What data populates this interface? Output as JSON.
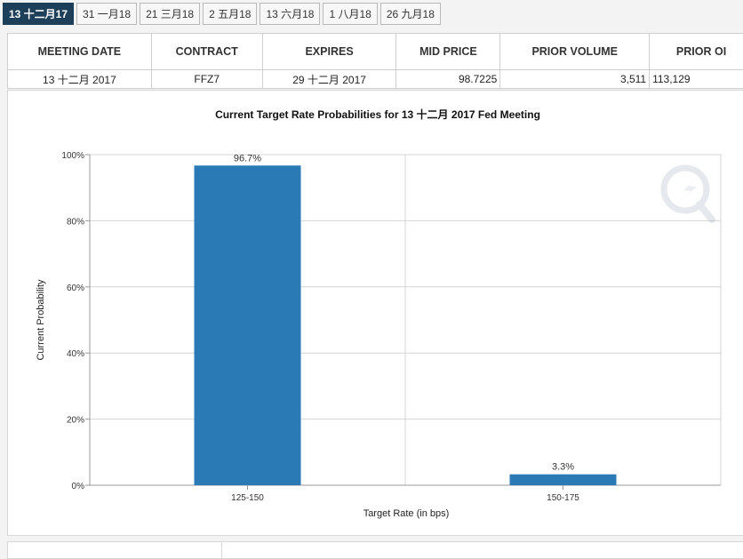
{
  "tabs": [
    "13 十二月17",
    "31 一月18",
    "21 三月18",
    "2 五月18",
    "13 六月18",
    "1 八月18",
    "26 九月18"
  ],
  "table": {
    "headers": [
      "MEETING DATE",
      "CONTRACT",
      "EXPIRES",
      "MID PRICE",
      "PRIOR VOLUME",
      "PRIOR OI"
    ],
    "row": [
      "13 十二月 2017",
      "FFZ7",
      "29 十二月 2017",
      "98.7225",
      "3,511",
      "113,129"
    ]
  },
  "colors": {
    "accent": "#1e3f5a",
    "bar": "#2a7ab5"
  },
  "watermark_icon": "qt-logo-icon",
  "chart_data": {
    "type": "bar",
    "title": "Current Target Rate Probabilities for 13 十二月 2017  Fed Meeting",
    "xlabel": "Target Rate (in bps)",
    "ylabel": "Current Probability",
    "categories": [
      "125-150",
      "150-175"
    ],
    "values": [
      96.7,
      3.3
    ],
    "data_labels": [
      "96.7%",
      "3.3%"
    ],
    "yticks": [
      "0%",
      "20%",
      "40%",
      "60%",
      "80%",
      "100%"
    ],
    "ylim": [
      0,
      100
    ],
    "grid": true
  }
}
